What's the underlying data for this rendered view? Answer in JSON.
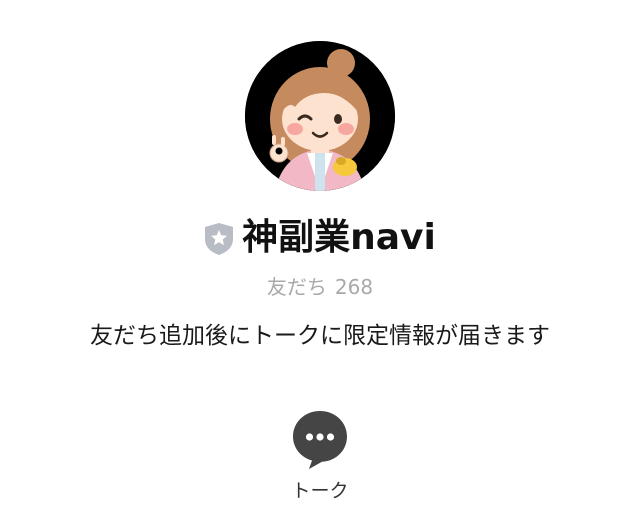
{
  "profile": {
    "avatar_icon": "mascot-avatar",
    "badge_icon": "verified-shield-star-icon",
    "name": "神副業navi",
    "friends_label": "友だち",
    "friends_count": "268",
    "status_message": "友だち追加後にトークに限定情報が届きます"
  },
  "actions": {
    "talk_icon": "chat-bubble-icon",
    "talk_label": "トーク"
  },
  "colors": {
    "background": "#ffffff",
    "text": "#111111",
    "muted": "#a9a9a9",
    "badge": "#b8bcc4",
    "talk_icon": "#454545"
  }
}
